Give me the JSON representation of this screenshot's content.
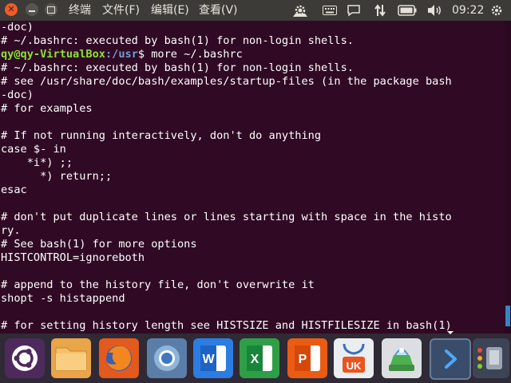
{
  "menubar": {
    "items": [
      {
        "label": "终端"
      },
      {
        "label": "文件(F)"
      },
      {
        "label": "编辑(E)"
      },
      {
        "label": "查看(V)"
      }
    ],
    "clock": "09:22"
  },
  "terminal": {
    "prompt_user": "qy@qy-VirtualBox",
    "prompt_path": ":/usr",
    "prompt_cmd": "$ more ~/.bashrc",
    "lines_before": [
      "-doc)",
      "# ~/.bashrc: executed by bash(1) for non-login shells."
    ],
    "lines_after": [
      "# ~/.bashrc: executed by bash(1) for non-login shells.",
      "# see /usr/share/doc/bash/examples/startup-files (in the package bash",
      "-doc)",
      "# for examples",
      "",
      "# If not running interactively, don't do anything",
      "case $- in",
      "    *i*) ;;",
      "      *) return;;",
      "esac",
      "",
      "# don't put duplicate lines or lines starting with space in the histo",
      "ry.",
      "# See bash(1) for more options",
      "HISTCONTROL=ignoreboth",
      "",
      "# append to the history file, don't overwrite it",
      "shopt -s histappend",
      "",
      "# for setting history length see HISTSIZE and HISTFILESIZE in bash(1)"
    ]
  },
  "launcher": {
    "ms_word_letter": "W",
    "ms_excel_letter": "X",
    "ms_ppt_letter": "P",
    "ukylin_label": "UK"
  },
  "colors": {
    "terminal_bg": "#300a24",
    "panel_bg": "#3c3b37",
    "prompt_user": "#8ae234",
    "prompt_path": "#729fcf",
    "close_button": "#f05b2c"
  }
}
